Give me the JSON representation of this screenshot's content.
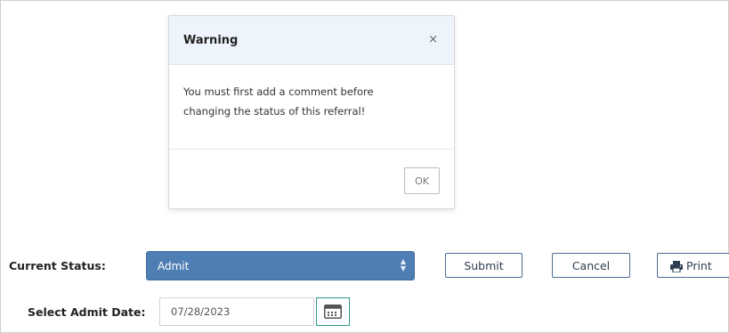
{
  "modal": {
    "title": "Warning",
    "close_icon": "close-icon",
    "message": "You must first add a comment before changing the status of this referral!",
    "ok_label": "OK"
  },
  "form": {
    "status_label": "Current Status:",
    "status_value": "Admit",
    "submit_label": "Submit",
    "cancel_label": "Cancel",
    "print_label": "Print",
    "print_icon": "printer-icon",
    "date_label": "Select Admit Date:",
    "date_value": "07/28/2023",
    "calendar_icon": "calendar-icon"
  },
  "colors": {
    "select_bg": "#4f7eb5",
    "modal_header_bg": "#eef4fb",
    "calendar_border": "#2e9a8a"
  }
}
